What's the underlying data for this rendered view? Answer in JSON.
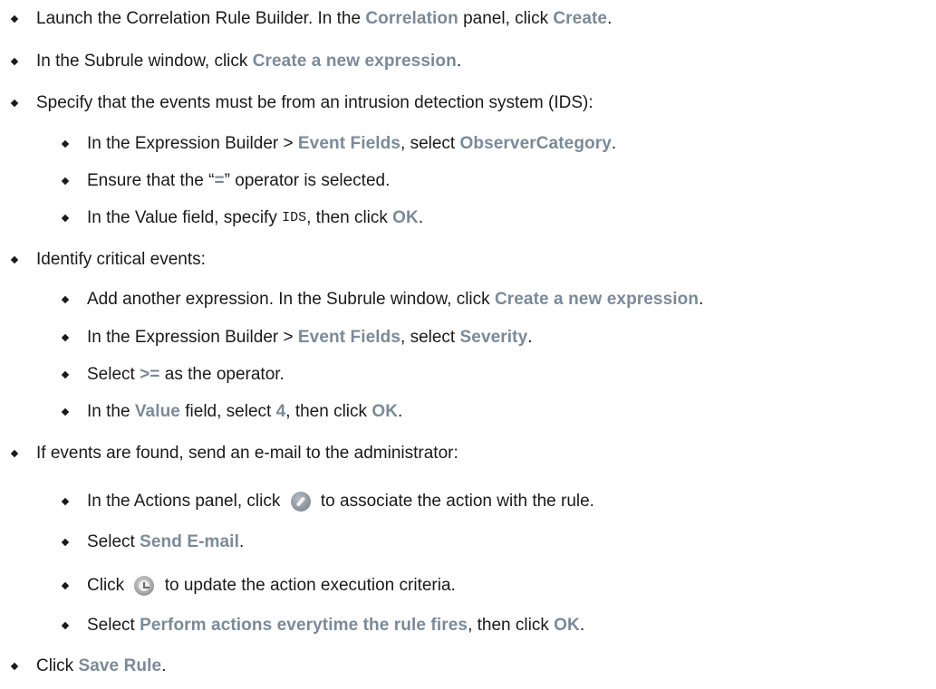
{
  "steps": [
    {
      "parts": [
        "Launch the Correlation Rule Builder. In the ",
        "Correlation",
        " panel, click ",
        "Create",
        "."
      ]
    },
    {
      "parts": [
        "In the Subrule window, click ",
        "Create a new expression",
        "."
      ]
    },
    {
      "parts": [
        "Specify that the events must be from an intrusion detection system (IDS):"
      ],
      "substeps": [
        {
          "parts": [
            "In the Expression Builder > ",
            "Event Fields",
            ", select ",
            "ObserverCategory",
            "."
          ]
        },
        {
          "parts": [
            "Ensure that the “",
            "=",
            "” operator is selected."
          ]
        },
        {
          "parts": [
            "In the Value field, specify ",
            "IDS",
            ", then click ",
            "OK",
            "."
          ]
        }
      ]
    },
    {
      "parts": [
        "Identify critical events:"
      ],
      "substeps": [
        {
          "parts": [
            "Add another expression. In the Subrule window, click ",
            "Create a new expression",
            "."
          ]
        },
        {
          "parts": [
            "In the Expression Builder > ",
            "Event Fields",
            ", select ",
            "Severity",
            "."
          ]
        },
        {
          "parts": [
            "Select ",
            ">=",
            " as the operator."
          ]
        },
        {
          "parts": [
            "In the ",
            "Value",
            " field, select ",
            "4",
            ", then click ",
            "OK",
            "."
          ]
        }
      ]
    },
    {
      "parts": [
        "If events are found, send an e-mail to the administrator:"
      ],
      "substeps": [
        {
          "parts": [
            "In the Actions panel, click ",
            " to associate the action with the rule."
          ],
          "icon": "wrench-icon"
        },
        {
          "parts": [
            "Select ",
            "Send E-mail",
            "."
          ]
        },
        {
          "parts": [
            "Click ",
            " to update the action execution criteria."
          ],
          "icon": "clock-icon"
        },
        {
          "parts": [
            "Select ",
            "Perform actions everytime the rule fires",
            ", then click ",
            "OK",
            "."
          ]
        }
      ]
    },
    {
      "parts": [
        "Click ",
        "Save Rule",
        "."
      ]
    }
  ],
  "colors": {
    "text": "#1a1a1a",
    "ui_element": "#7b8a98",
    "background": "#ffffff"
  }
}
